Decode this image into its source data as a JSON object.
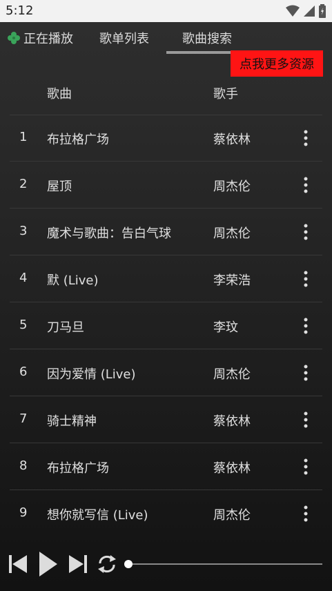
{
  "status_bar": {
    "time": "5:12"
  },
  "tabs": [
    {
      "label": "正在播放",
      "selected": false
    },
    {
      "label": "歌单列表",
      "selected": false
    },
    {
      "label": "歌曲搜索",
      "selected": true
    }
  ],
  "promo_button": {
    "label": "点我更多资源",
    "color": "#ff1414"
  },
  "table": {
    "headers": {
      "song": "歌曲",
      "artist": "歌手"
    },
    "rows": [
      {
        "index": "1",
        "song": "布拉格广场",
        "artist": "蔡依林"
      },
      {
        "index": "2",
        "song": "屋顶",
        "artist": "周杰伦"
      },
      {
        "index": "3",
        "song": "魔术与歌曲：告白气球",
        "artist": "周杰伦"
      },
      {
        "index": "4",
        "song": "默 (Live)",
        "artist": "李荣浩"
      },
      {
        "index": "5",
        "song": "刀马旦",
        "artist": "李玟"
      },
      {
        "index": "6",
        "song": "因为爱情 (Live)",
        "artist": "周杰伦"
      },
      {
        "index": "7",
        "song": "骑士精神",
        "artist": "蔡依林"
      },
      {
        "index": "8",
        "song": "布拉格广场",
        "artist": "蔡依林"
      },
      {
        "index": "9",
        "song": "想你就写信 (Live)",
        "artist": "周杰伦"
      }
    ]
  },
  "player": {
    "icons": [
      "previous-icon",
      "play-icon",
      "next-icon",
      "repeat-icon"
    ],
    "progress": 0
  }
}
